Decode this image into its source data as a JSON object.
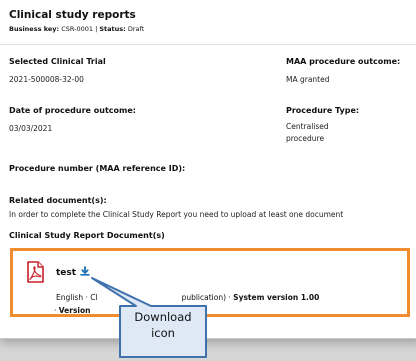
{
  "header": {
    "title": "Clinical study reports",
    "business_key_label": "Business key:",
    "business_key": "CSR-0001",
    "separator": "|",
    "status_label": "Status:",
    "status": "Draft"
  },
  "fields": {
    "selected_trial_label": "Selected Clinical Trial",
    "selected_trial_value": "2021-500008-32-00",
    "maa_outcome_label": "MAA procedure outcome:",
    "maa_outcome_value": "MA granted",
    "date_label": "Date of procedure outcome:",
    "date_value": "03/03/2021",
    "procedure_type_label": "Procedure Type:",
    "procedure_type_line1": "Centralised",
    "procedure_type_line2": "procedure",
    "procedure_number_label": "Procedure number (MAA reference ID):"
  },
  "related": {
    "label": "Related document(s):",
    "instruction": "In order to complete the Clinical Study Report you need to upload at least one document",
    "section_label": "Clinical Study Report Document(s)"
  },
  "document": {
    "name": "test",
    "icon": "pdf-icon",
    "download_icon": "download-icon",
    "meta_prefix": "English · Cl",
    "meta_suffix": "publication) · ",
    "system_version": "System version 1.00",
    "meta_line2_prefix": "· ",
    "version_text": "Version"
  },
  "annotation": {
    "line1": "Download",
    "line2": "icon"
  },
  "colors": {
    "highlight_border": "#f08c2d",
    "callout_fill": "#dfe9f5",
    "callout_border": "#3f72ad",
    "pdf_red": "#c8202a",
    "download_blue": "#1d6fb8"
  }
}
